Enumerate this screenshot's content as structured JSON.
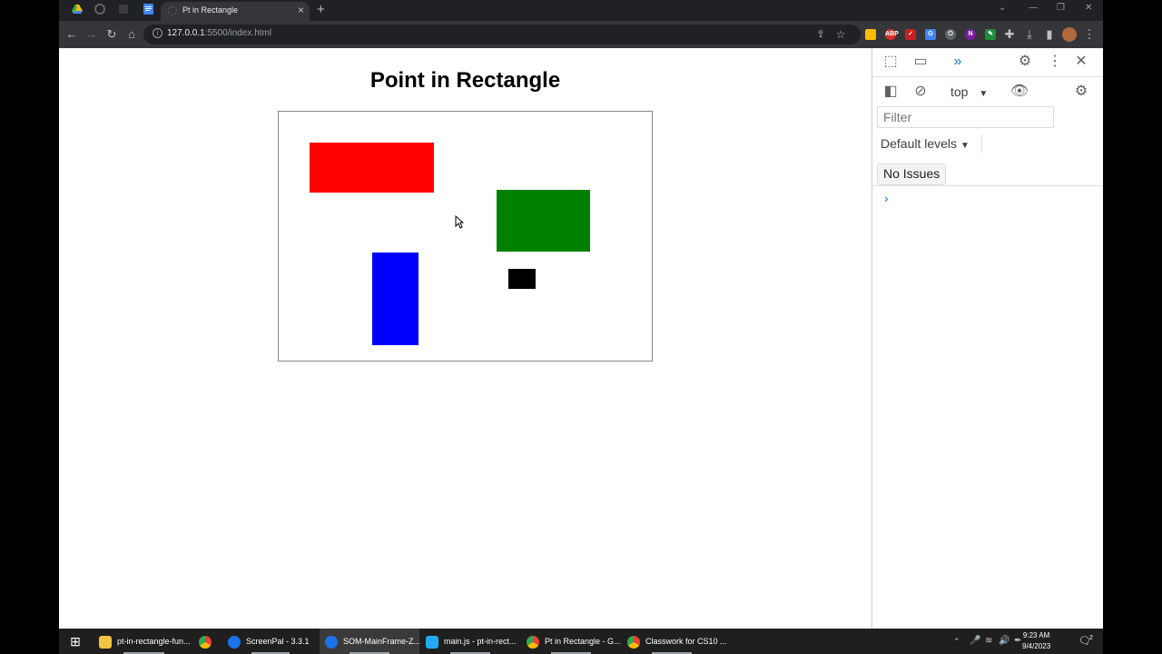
{
  "browser": {
    "active_tab_title": "Pt in Rectangle",
    "new_tab_symbol": "+",
    "close_symbol": "×",
    "url_host": "127.0.0.1",
    "url_rest": ":5500/index.html"
  },
  "page": {
    "title": "Point in Rectangle",
    "shapes": [
      {
        "name": "red-rectangle",
        "color": "#ff0000"
      },
      {
        "name": "green-rectangle",
        "color": "#008000"
      },
      {
        "name": "blue-rectangle",
        "color": "#0000ff"
      },
      {
        "name": "black-rectangle",
        "color": "#000000"
      }
    ]
  },
  "devtools": {
    "context": "top",
    "filter_placeholder": "Filter",
    "levels_label": "Default levels",
    "issues_label": "No Issues",
    "prompt_symbol": "›"
  },
  "taskbar": {
    "items": [
      {
        "label": "pt-in-rectangle-fun..."
      },
      {
        "label": ""
      },
      {
        "label": "ScreenPal - 3.3.1"
      },
      {
        "label": "SOM-MainFrame-Z..."
      },
      {
        "label": "main.js - pt-in-rect..."
      },
      {
        "label": "Pt in Rectangle - G..."
      },
      {
        "label": "Classwork for CS10 ..."
      }
    ],
    "time": "9:23 AM",
    "date": "9/4/2023",
    "notification_count": "2"
  }
}
